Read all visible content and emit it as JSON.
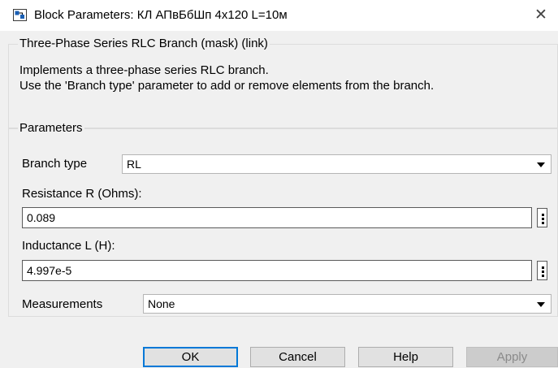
{
  "window": {
    "title": "Block Parameters: КЛ АПвБбШп 4х120 L=10м",
    "close_glyph": "✕"
  },
  "description": {
    "legend": "Three-Phase Series RLC Branch (mask) (link)",
    "line1": "Implements a three-phase series RLC branch.",
    "line2": "Use the 'Branch type' parameter to add or remove elements from the branch."
  },
  "parameters": {
    "legend": "Parameters",
    "branch_type": {
      "label": "Branch type",
      "value": "RL"
    },
    "resistance": {
      "label": "Resistance R (Ohms):",
      "value": "0.089"
    },
    "inductance": {
      "label": "Inductance L (H):",
      "value": "4.997e-5"
    },
    "measurements": {
      "label": "Measurements",
      "value": "None"
    }
  },
  "buttons": {
    "ok": "OK",
    "cancel": "Cancel",
    "help": "Help",
    "apply": "Apply"
  },
  "icons": {
    "window_icon": "simulink-block-icon",
    "close": "close-icon",
    "dropdown": "chevron-down-icon",
    "more": "more-options-icon"
  },
  "colors": {
    "dialog_background": "#f0f0f0",
    "default_button_border": "#0078d7",
    "disabled_text": "#8a8a8a"
  }
}
